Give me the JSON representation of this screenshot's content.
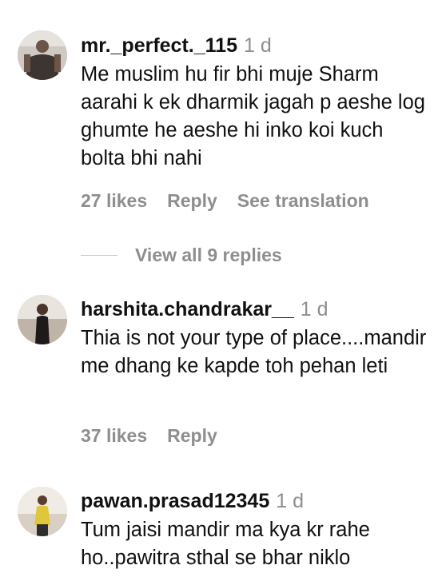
{
  "comments": [
    {
      "username": "mr._perfect._115",
      "time": "1 d",
      "text": "Me muslim hu fir bhi muje Sharm aarahi k ek dharmik jagah p aeshe log ghumte he aeshe hi inko koi kuch bolta bhi nahi",
      "likes": "27 likes",
      "reply": "Reply",
      "translation": "See translation",
      "view_replies": "View all 9 replies"
    },
    {
      "username": "harshita.chandrakar__",
      "time": "1 d",
      "text": "Thia is not your type of place....mandir me dhang ke kapde toh pehan leti",
      "likes": "37 likes",
      "reply": "Reply"
    },
    {
      "username": "pawan.prasad12345",
      "time": "1 d",
      "text": "Tum jaisi mandir ma kya kr rahe ho..pawitra sthal se bhar niklo"
    }
  ]
}
